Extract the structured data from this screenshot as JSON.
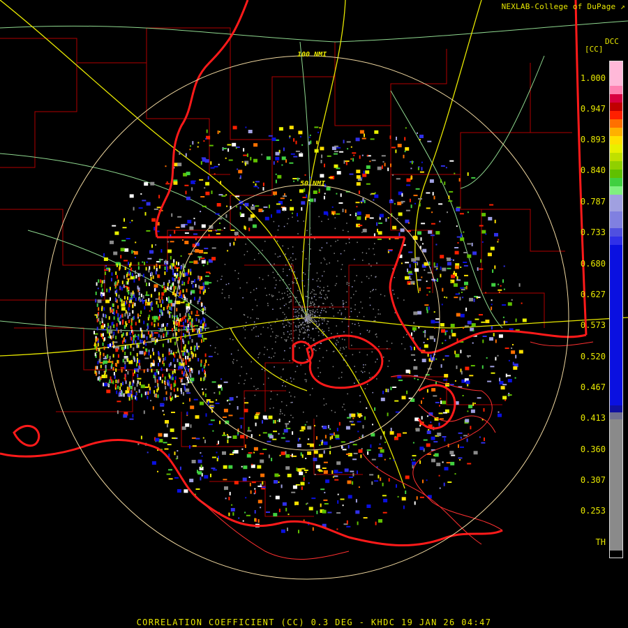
{
  "credit": "NEXLAB-College of DuPage",
  "legend": {
    "product": "DCC",
    "unit": "[CC]",
    "ticks": [
      "1.000",
      "0.947",
      "0.893",
      "0.840",
      "0.787",
      "0.733",
      "0.680",
      "0.627",
      "0.573",
      "0.520",
      "0.467",
      "0.413",
      "0.360",
      "0.307",
      "0.253",
      "TH"
    ],
    "colors": {
      "text": "#e8e800",
      "border": "#dddddd",
      "state_line": "#ff1a1a",
      "county_line": "#b00000",
      "interstate": "#e8e800",
      "highway": "#8fd88f",
      "range_ring": "#f0d8a0"
    }
  },
  "range_rings": [
    {
      "label": "50 NMI"
    },
    {
      "label": "100 NMI"
    }
  ],
  "footer": "CORRELATION COEFFICIENT (CC) 0.3 DEG - KHDC 19 JAN 26 04:47"
}
